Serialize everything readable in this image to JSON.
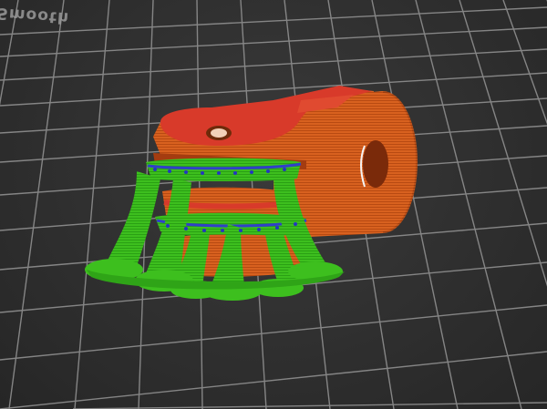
{
  "viewport": {
    "bed_label": "Smooth",
    "bed_color": "#2e2e2e",
    "grid_color": "#8a8a8a",
    "model_color": "#d85a1c",
    "top_surface_color": "#d83a2a",
    "support_color": "#3cbf1c",
    "perimeter_color": "#3a4bd0"
  }
}
